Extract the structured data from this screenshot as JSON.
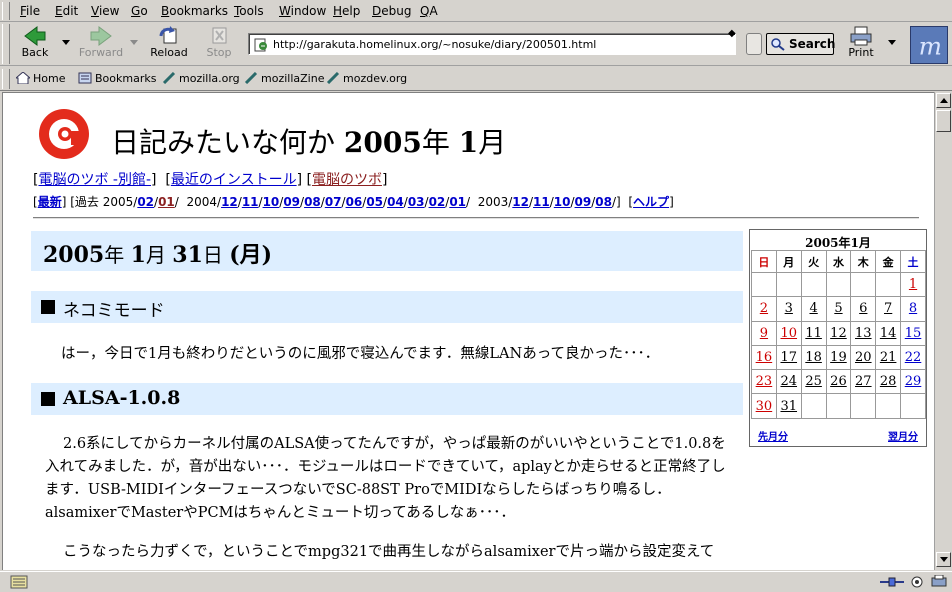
{
  "menu": [
    "File",
    "Edit",
    "View",
    "Go",
    "Bookmarks",
    "Tools",
    "Window",
    "Help",
    "Debug",
    "QA"
  ],
  "nav": {
    "back": "Back",
    "forward": "Forward",
    "reload": "Reload",
    "stop": "Stop",
    "url": "http://garakuta.homelinux.org/~nosuke/diary/200501.html",
    "search": "Search",
    "print": "Print"
  },
  "bookmarks": [
    "Home",
    "Bookmarks",
    "mozilla.org",
    "mozillaZine",
    "mozdev.org"
  ],
  "page": {
    "title_a": "日記みたいな何か ",
    "title_year": "2005",
    "title_nen": "年 ",
    "title_month": "1",
    "title_gatsu": "月",
    "links": [
      "電脳のツボ -別館-",
      "最近のインストール",
      "電脳のツボ"
    ],
    "archive": {
      "latest": "最新",
      "past_label": "過去",
      "y2005": "2005/",
      "m2005": [
        "02",
        "01"
      ],
      "y2004": "2004/",
      "m2004": [
        "12",
        "11",
        "10",
        "09",
        "08",
        "07",
        "06",
        "05",
        "04",
        "03",
        "02",
        "01"
      ],
      "y2003": "2003/",
      "m2003": [
        "12",
        "11",
        "10",
        "09",
        "08"
      ],
      "help": "ヘルプ"
    },
    "date": {
      "year": "2005",
      "nen": "年 ",
      "month": "1",
      "gatsu": "月 ",
      "day": "31",
      "nichi": "日 ",
      "weekday": "(月)"
    },
    "sections": [
      {
        "title": "ネコミモード",
        "paragraphs": [
          "はー，今日で1月も終わりだというのに風邪で寝込んでます．無線LANあって良かった･･･．"
        ]
      },
      {
        "title": "ALSA-1.0.8",
        "paragraphs": [
          "2.6系にしてからカーネル付属のALSA使ってたんですが，やっぱ最新のがいいやということで1.0.8を入れてみました．が，音が出ない･･･．モジュールはロードできていて，aplayとか走らせると正常終了します．USB-MIDIインターフェースつないでSC-88ST ProでMIDIならしたらばっちり鳴るし．alsamixerでMasterやPCMはちゃんとミュート切ってあるしなぁ･･･．",
          "こうなったら力ずくで，ということでmpg321で曲再生しながらalsamixerで片っ端から設定変えて"
        ]
      }
    ]
  },
  "calendar": {
    "title": "2005年1月",
    "weekdays": [
      "日",
      "月",
      "火",
      "水",
      "木",
      "金",
      "土"
    ],
    "weeks": [
      [
        "",
        "",
        "",
        "",
        "",
        "",
        "1"
      ],
      [
        "2",
        "3",
        "4",
        "5",
        "6",
        "7",
        "8"
      ],
      [
        "9",
        "10",
        "11",
        "12",
        "13",
        "14",
        "15"
      ],
      [
        "16",
        "17",
        "18",
        "19",
        "20",
        "21",
        "22"
      ],
      [
        "23",
        "24",
        "25",
        "26",
        "27",
        "28",
        "29"
      ],
      [
        "30",
        "31",
        "",
        "",
        "",
        "",
        ""
      ]
    ],
    "prev": "先月分",
    "next": "翌月分",
    "colors": {
      "sunday": "#cc0000",
      "saturday": "#0000cc",
      "holiday_sat": "#cc0000"
    }
  },
  "colors": {
    "header_band": "#ddeeff",
    "link": "#0000cc",
    "visited": "#8b2020"
  }
}
